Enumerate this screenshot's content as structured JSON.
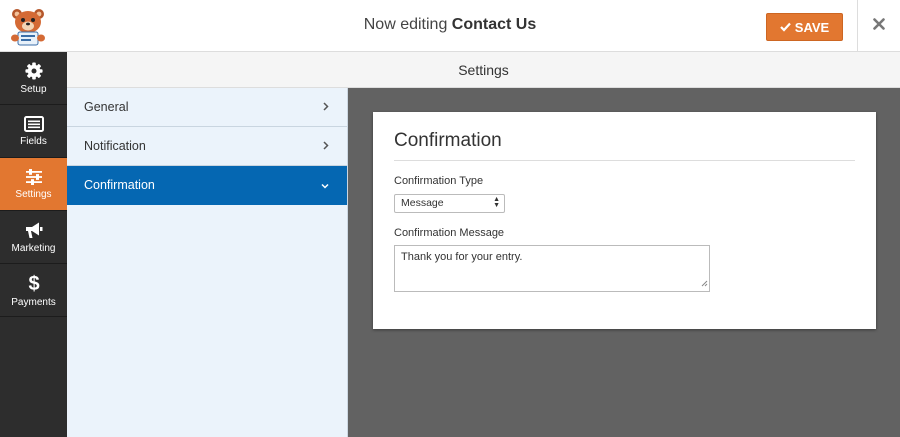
{
  "header": {
    "title_prefix": "Now editing",
    "form_name": "Contact Us",
    "save_label": "SAVE",
    "accent_color": "#e27730"
  },
  "sidebar": {
    "items": [
      {
        "label": "Setup",
        "icon": "gear-icon"
      },
      {
        "label": "Fields",
        "icon": "list-icon"
      },
      {
        "label": "Settings",
        "icon": "sliders-icon",
        "active": true
      },
      {
        "label": "Marketing",
        "icon": "megaphone-icon"
      },
      {
        "label": "Payments",
        "icon": "dollar-icon"
      }
    ]
  },
  "settings": {
    "header": "Settings",
    "panels": [
      {
        "label": "General",
        "icon": "chevron-right-icon"
      },
      {
        "label": "Notification",
        "icon": "chevron-right-icon"
      },
      {
        "label": "Confirmation",
        "icon": "chevron-down-icon",
        "active": true
      }
    ]
  },
  "confirmation": {
    "title": "Confirmation",
    "type_label": "Confirmation Type",
    "type_value": "Message",
    "message_label": "Confirmation Message",
    "message_value": "Thank you for your entry."
  }
}
